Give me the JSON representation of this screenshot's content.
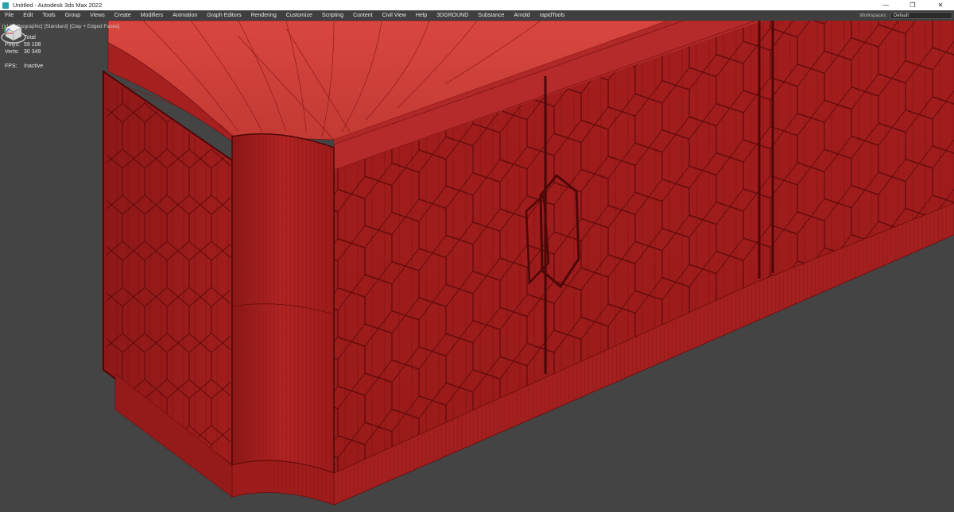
{
  "window": {
    "title": "Untitled - Autodesk 3ds Max 2022",
    "minimize_icon": "minimize-icon",
    "maximize_icon": "restore-icon",
    "close_icon": "close-icon"
  },
  "menubar": {
    "items": [
      "File",
      "Edit",
      "Tools",
      "Group",
      "Views",
      "Create",
      "Modifiers",
      "Animation",
      "Graph Editors",
      "Rendering",
      "Customize",
      "Scripting",
      "Content",
      "Civil View",
      "Help",
      "3DGROUND",
      "Substance",
      "Arnold",
      "rapidTools"
    ],
    "workspaces_label": "Workspaces:",
    "workspace_value": "Default"
  },
  "viewport": {
    "labels": [
      "[+]",
      "[Orthographic]",
      "[Standard]",
      "[Clay + Edged Faces]"
    ],
    "stats": {
      "header": "Total",
      "polys_label": "Polys:",
      "polys_value": "59 108",
      "verts_label": "Verts:",
      "verts_value": "30 349",
      "fps_label": "FPS:",
      "fps_value": "Inactive"
    },
    "model_color": "#a81e1e",
    "wire_color": "#5a0909",
    "background_color": "#444444"
  }
}
